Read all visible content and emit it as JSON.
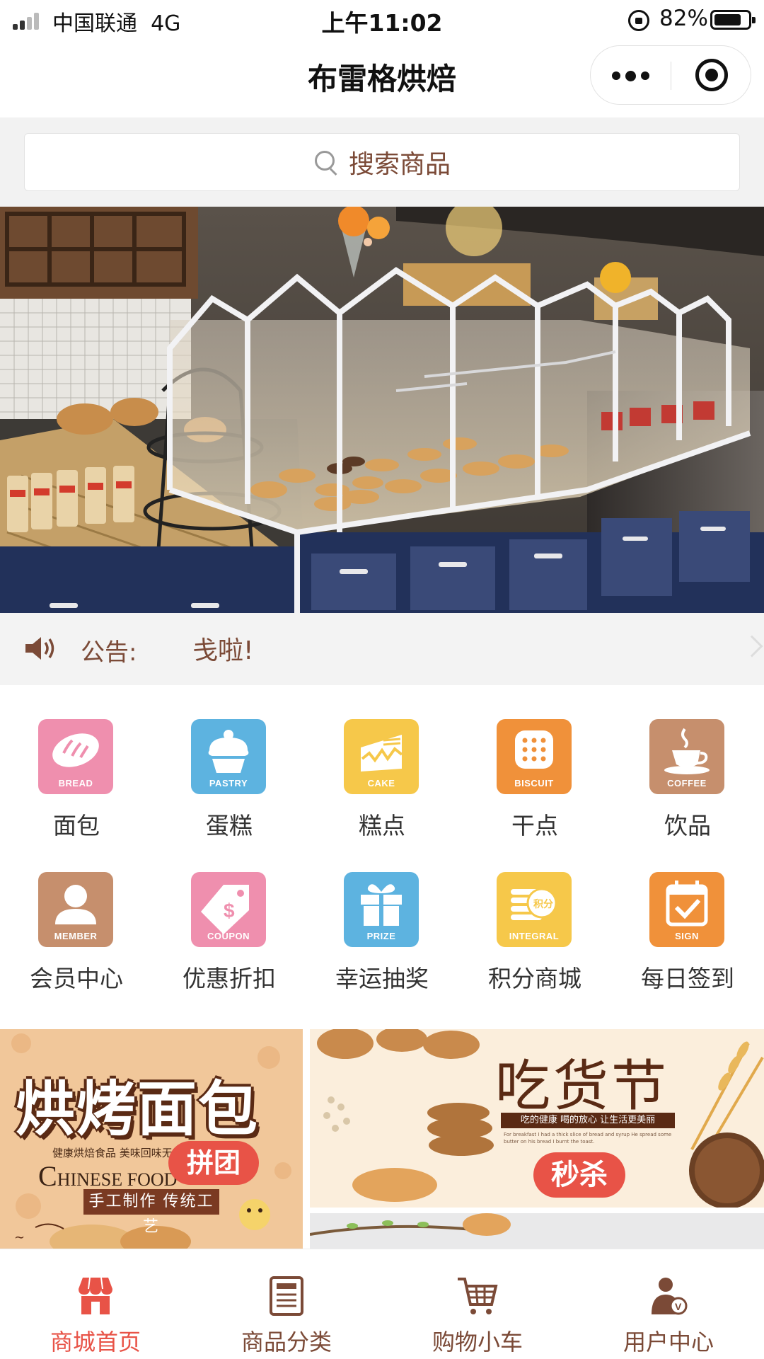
{
  "status_bar": {
    "carrier": "中国联通",
    "network": "4G",
    "time": "上午11:02",
    "battery": "82%",
    "battery_level": 0.82
  },
  "nav": {
    "title": "布雷格烘焙"
  },
  "search": {
    "placeholder": "搜索商品"
  },
  "notice": {
    "label": "公告:",
    "text": "戋啦!"
  },
  "categories": [
    {
      "label": "面包",
      "en": "BREAD",
      "color": "#ef8fae",
      "icon": "bread-icon"
    },
    {
      "label": "蛋糕",
      "en": "PASTRY",
      "color": "#5db3e0",
      "icon": "cupcake-icon"
    },
    {
      "label": "糕点",
      "en": "CAKE",
      "color": "#f6c84a",
      "icon": "cake-slice-icon"
    },
    {
      "label": "干点",
      "en": "BISCUIT",
      "color": "#f0913a",
      "icon": "biscuit-icon"
    },
    {
      "label": "饮品",
      "en": "COFFEE",
      "color": "#c68f6d",
      "icon": "coffee-icon"
    },
    {
      "label": "会员中心",
      "en": "MEMBER",
      "color": "#c68f6d",
      "icon": "member-icon"
    },
    {
      "label": "优惠折扣",
      "en": "COUPON",
      "color": "#ef8fae",
      "icon": "coupon-tag-icon"
    },
    {
      "label": "幸运抽奖",
      "en": "PRIZE",
      "color": "#5db3e0",
      "icon": "gift-icon"
    },
    {
      "label": "积分商城",
      "en": "INTEGRAL",
      "color": "#f6c84a",
      "icon": "points-coin-icon"
    },
    {
      "label": "每日签到",
      "en": "SIGN",
      "color": "#f0913a",
      "icon": "calendar-check-icon"
    }
  ],
  "promos": {
    "left": {
      "title": "烘烤面包",
      "tagline": "健康烘焙食品 美味回味无穷",
      "english": "HINESE FOOD",
      "english_initial": "C",
      "badge": "拼团",
      "ribbon": "手工制作 传统工艺"
    },
    "right": {
      "title": "吃货节",
      "subtitle": "吃的健康 喝的放心 让生活更美丽",
      "description": "For breakfast I had a thick slice of bread and syrup He spread some butter on his bread I burnt the toast.",
      "badge": "秒杀"
    }
  },
  "tabs": [
    {
      "label": "商城首页",
      "icon": "store-icon",
      "active": true
    },
    {
      "label": "商品分类",
      "icon": "list-icon",
      "active": false
    },
    {
      "label": "购物小车",
      "icon": "cart-icon",
      "active": false
    },
    {
      "label": "用户中心",
      "icon": "user-icon",
      "active": false
    }
  ],
  "colors": {
    "accent": "#e85347",
    "brown": "#7b4a37"
  }
}
